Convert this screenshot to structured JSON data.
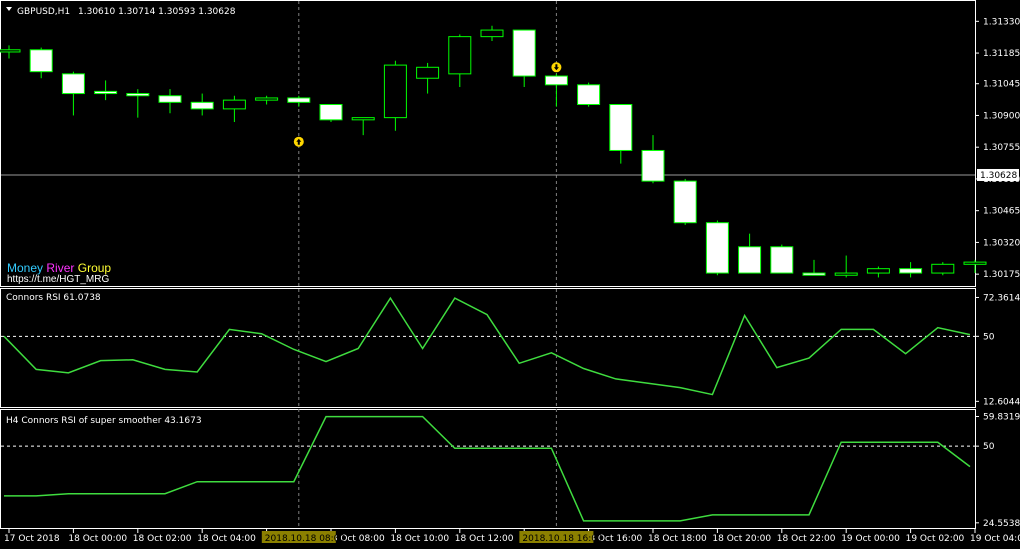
{
  "header": {
    "symbol": "GBPUSD,H1",
    "ohlc": "1.30610 1.30714 1.30593 1.30628"
  },
  "brand": {
    "word1": "Money",
    "word2": "River",
    "word3": "Group",
    "url": "https://t.me/HGT_MRG",
    "colors": {
      "word1": "#33ccff",
      "word2": "#ff33ff",
      "word3": "#ffff33"
    }
  },
  "colors": {
    "background": "#000000",
    "axis": "#ffffff",
    "candle_body": "#ffffff",
    "candle_outline": "#00ff00",
    "indicator_line": "#3fdc3f",
    "grid_vline": "#808080",
    "arrow": "#ffd700",
    "marker_label_bg": "#8b8000"
  },
  "chart_data": [
    {
      "type": "candlestick",
      "title": "GBPUSD,H1",
      "y_ticks": [
        "1.31330",
        "1.31185",
        "1.31045",
        "1.30900",
        "1.30755",
        "1.30610",
        "1.30465",
        "1.30320",
        "1.30175"
      ],
      "y_tick_values": [
        1.3133,
        1.31185,
        1.31045,
        1.309,
        1.30755,
        1.3061,
        1.30465,
        1.3032,
        1.30175
      ],
      "ylim": [
        1.3013,
        1.314
      ],
      "current_price": "1.30628",
      "current_price_value": 1.30628,
      "candles": [
        {
          "o": 1.3119,
          "h": 1.3122,
          "l": 1.3116,
          "c": 1.312
        },
        {
          "o": 1.312,
          "h": 1.3121,
          "l": 1.3107,
          "c": 1.311
        },
        {
          "o": 1.3109,
          "h": 1.311,
          "l": 1.309,
          "c": 1.31
        },
        {
          "o": 1.3101,
          "h": 1.3106,
          "l": 1.3097,
          "c": 1.31
        },
        {
          "o": 1.31,
          "h": 1.3102,
          "l": 1.3089,
          "c": 1.3099
        },
        {
          "o": 1.3099,
          "h": 1.3102,
          "l": 1.3091,
          "c": 1.3096
        },
        {
          "o": 1.3096,
          "h": 1.31,
          "l": 1.309,
          "c": 1.3093
        },
        {
          "o": 1.3093,
          "h": 1.3099,
          "l": 1.3087,
          "c": 1.3097
        },
        {
          "o": 1.3097,
          "h": 1.3099,
          "l": 1.3095,
          "c": 1.3098
        },
        {
          "o": 1.3098,
          "h": 1.3099,
          "l": 1.3094,
          "c": 1.3096
        },
        {
          "o": 1.3095,
          "h": 1.3095,
          "l": 1.3087,
          "c": 1.3088
        },
        {
          "o": 1.3088,
          "h": 1.3089,
          "l": 1.3081,
          "c": 1.3089
        },
        {
          "o": 1.3089,
          "h": 1.3115,
          "l": 1.3083,
          "c": 1.3113
        },
        {
          "o": 1.3107,
          "h": 1.3114,
          "l": 1.31,
          "c": 1.3112
        },
        {
          "o": 1.3109,
          "h": 1.3127,
          "l": 1.3103,
          "c": 1.3126
        },
        {
          "o": 1.3126,
          "h": 1.3131,
          "l": 1.3124,
          "c": 1.3129
        },
        {
          "o": 1.3129,
          "h": 1.3128,
          "l": 1.3103,
          "c": 1.3108
        },
        {
          "o": 1.3108,
          "h": 1.3109,
          "l": 1.3094,
          "c": 1.3104
        },
        {
          "o": 1.3104,
          "h": 1.3105,
          "l": 1.3094,
          "c": 1.3095
        },
        {
          "o": 1.3095,
          "h": 1.3095,
          "l": 1.3068,
          "c": 1.3074
        },
        {
          "o": 1.3074,
          "h": 1.3081,
          "l": 1.3059,
          "c": 1.306
        },
        {
          "o": 1.306,
          "h": 1.3061,
          "l": 1.304,
          "c": 1.3041
        },
        {
          "o": 1.3041,
          "h": 1.3042,
          "l": 1.3017,
          "c": 1.3018
        },
        {
          "o": 1.303,
          "h": 1.3036,
          "l": 1.3018,
          "c": 1.3018
        },
        {
          "o": 1.303,
          "h": 1.3031,
          "l": 1.3018,
          "c": 1.3018
        },
        {
          "o": 1.3018,
          "h": 1.3024,
          "l": 1.3017,
          "c": 1.3017
        },
        {
          "o": 1.3017,
          "h": 1.3026,
          "l": 1.3016,
          "c": 1.3018
        },
        {
          "o": 1.3018,
          "h": 1.3021,
          "l": 1.3016,
          "c": 1.302
        },
        {
          "o": 1.302,
          "h": 1.3023,
          "l": 1.3016,
          "c": 1.3018
        },
        {
          "o": 1.3018,
          "h": 1.3023,
          "l": 1.3017,
          "c": 1.3022
        },
        {
          "o": 1.3022,
          "h": 1.3024,
          "l": 1.3018,
          "c": 1.3023
        }
      ],
      "arrows": [
        {
          "candle": 9,
          "direction": "up",
          "price": 1.3078
        },
        {
          "candle": 17,
          "direction": "down",
          "price": 1.3112
        }
      ]
    },
    {
      "type": "line",
      "title": "Connors RSI 61.0738",
      "y_ticks": [
        "72.3614",
        "50",
        "12.6044"
      ],
      "y_tick_values": [
        72.3614,
        50,
        12.6044
      ],
      "ylim": [
        10.5,
        75.5
      ],
      "level": 50,
      "series": [
        {
          "values": [
            50,
            31,
            29,
            36,
            36.5,
            31,
            29.5,
            54,
            51.5,
            42.5,
            35.5,
            43,
            72,
            43,
            72,
            62.5,
            34.5,
            40.5,
            31.5,
            25.5,
            23,
            20.5,
            16.5,
            62,
            32,
            37.5,
            54,
            54,
            40,
            55,
            51
          ]
        }
      ]
    },
    {
      "type": "line",
      "title": "H4 Connors RSI of super smoother 43.1673",
      "y_ticks": [
        "59.8319",
        "50",
        "24.5538"
      ],
      "y_tick_values": [
        59.8319,
        50,
        24.5538
      ],
      "ylim": [
        23.5,
        61
      ],
      "level": 50,
      "series": [
        {
          "values": [
            33.5,
            33.5,
            34.2,
            34.2,
            34.2,
            34.2,
            38.2,
            38.2,
            38.2,
            38.2,
            59.8,
            59.8,
            59.8,
            59.8,
            49.3,
            49.3,
            49.3,
            49.3,
            25.2,
            25.2,
            25.2,
            25.2,
            27.2,
            27.2,
            27.2,
            27.2,
            51.3,
            51.3,
            51.3,
            51.3,
            43.2
          ]
        }
      ]
    }
  ],
  "x_axis": {
    "labels": [
      "17 Oct 2018",
      "18 Oct 00:00",
      "18 Oct 02:00",
      "18 Oct 04:00",
      "18 Oct 06:00",
      "18 Oct 08:00",
      "18 Oct 10:00",
      "18 Oct 12:00",
      "18 Oct 14:00",
      "18 Oct 16:00",
      "18 Oct 18:00",
      "18 Oct 20:00",
      "18 Oct 22:00",
      "19 Oct 00:00",
      "19 Oct 02:00",
      "19 Oct 04:00"
    ],
    "label_candles": [
      0,
      2,
      4,
      6,
      8,
      10,
      12,
      14,
      16,
      18,
      20,
      22,
      24,
      26,
      28,
      30
    ],
    "markers": [
      {
        "candle": 9,
        "label": "2018.10.18 08:00"
      },
      {
        "candle": 17,
        "label": "2018.10.18 16:00"
      }
    ]
  }
}
